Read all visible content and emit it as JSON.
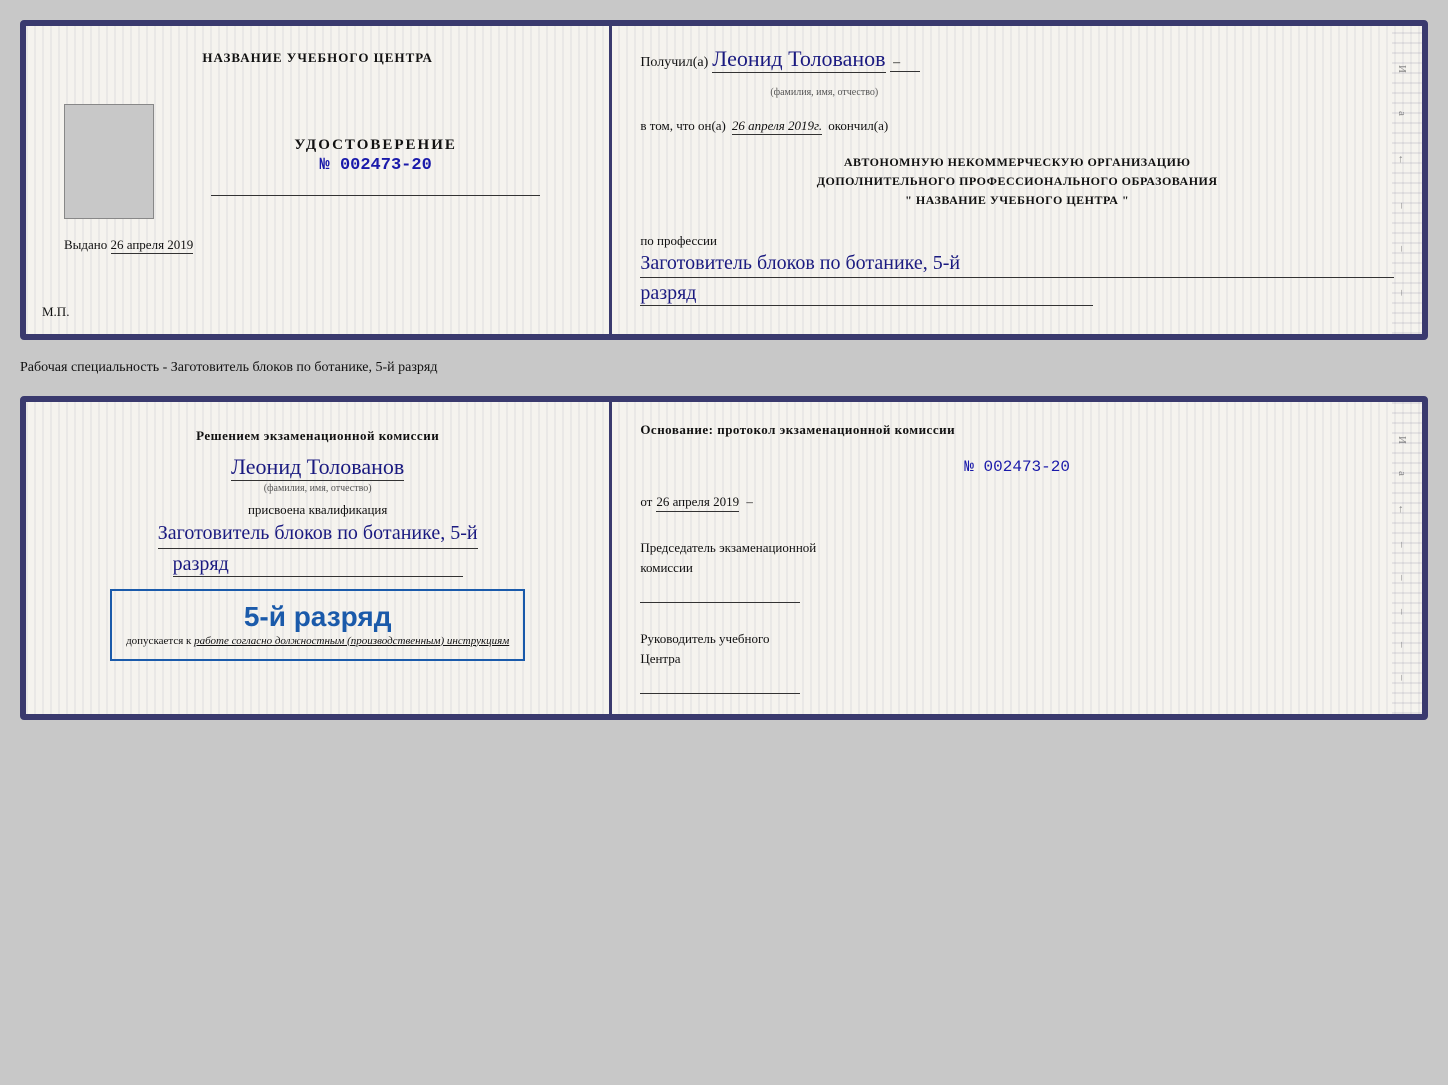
{
  "card1": {
    "left": {
      "center_name": "НАЗВАНИЕ УЧЕБНОГО ЦЕНТРА",
      "udostoverenie_label": "УДОСТОВЕРЕНИЕ",
      "number": "№ 002473-20",
      "photo_alt": "Фото",
      "vydano_prefix": "Выдано",
      "vydano_date": "26 апреля 2019",
      "mp": "М.П."
    },
    "right": {
      "poluchil_prefix": "Получил(а)",
      "recipient_name": "Леонид Толованов",
      "fio_caption": "(фамилия, имя, отчество)",
      "vtom_prefix": "в том, что он(а)",
      "vtom_date": "26 апреля 2019г.",
      "okonchil": "окончил(а)",
      "org_line1": "АВТОНОМНУЮ НЕКОММЕРЧЕСКУЮ ОРГАНИЗАЦИЮ",
      "org_line2": "ДОПОЛНИТЕЛЬНОГО ПРОФЕССИОНАЛЬНОГО ОБРАЗОВАНИЯ",
      "org_line3": "\"  НАЗВАНИЕ УЧЕБНОГО ЦЕНТРА  \"",
      "po_professii": "по профессии",
      "profession": "Заготовитель блоков по ботанике, 5-й",
      "razryad": "разряд"
    }
  },
  "specialty_label": "Рабочая специальность - Заготовитель блоков по ботанике, 5-й разряд",
  "card2": {
    "left": {
      "resheniem": "Решением экзаменационной комиссии",
      "person_name": "Леонид Толованов",
      "fio_caption": "(фамилия, имя, отчество)",
      "prisvoena": "присвоена квалификация",
      "qualification": "Заготовитель блоков по ботанике, 5-й",
      "razryad": "разряд",
      "stamp_grade": "5-й разряд",
      "dopusk_prefix": "допускается к",
      "dopusk_text": "работе согласно должностным (производственным) инструкциям"
    },
    "right": {
      "osnovanie": "Основание: протокол экзаменационной комиссии",
      "number": "№  002473-20",
      "ot_prefix": "от",
      "ot_date": "26 апреля 2019",
      "predsedatel_label1": "Председатель экзаменационной",
      "predsedatel_label2": "комиссии",
      "rukovoditel_label1": "Руководитель учебного",
      "rukovoditel_label2": "Центра"
    }
  },
  "side_chars": [
    "И",
    "а",
    "←",
    "–",
    "–",
    "–",
    "–",
    "–"
  ]
}
